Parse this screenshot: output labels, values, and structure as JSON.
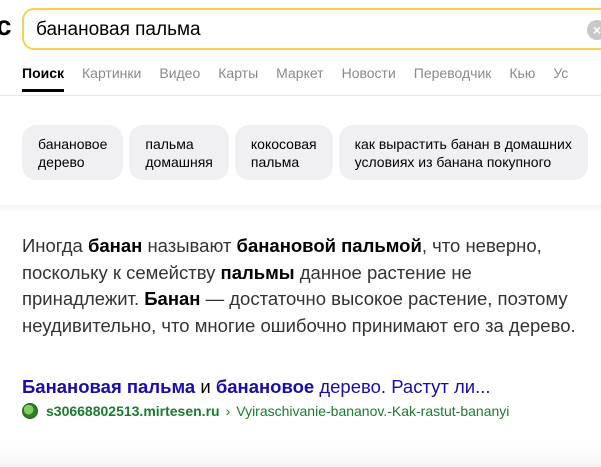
{
  "search": {
    "logo_fragment": "с",
    "query": "банановая пальма",
    "clear_icon": "×"
  },
  "tabs": [
    {
      "label": "Поиск",
      "active": true
    },
    {
      "label": "Картинки",
      "active": false
    },
    {
      "label": "Видео",
      "active": false
    },
    {
      "label": "Карты",
      "active": false
    },
    {
      "label": "Маркет",
      "active": false
    },
    {
      "label": "Новости",
      "active": false
    },
    {
      "label": "Переводчик",
      "active": false
    },
    {
      "label": "Кью",
      "active": false
    },
    {
      "label": "Ус",
      "active": false
    }
  ],
  "related": [
    {
      "line1": "банановое",
      "line2": "дерево"
    },
    {
      "line1": "пальма",
      "line2": "домашняя"
    },
    {
      "line1": "кокосовая",
      "line2": "пальма"
    },
    {
      "line1": "как вырастить банан в домашних",
      "line2": "условиях из банана покупного"
    }
  ],
  "result": {
    "snippet": {
      "p1": "Иногда ",
      "b1": "банан",
      "p2": " называют ",
      "b2": "банановой пальмой",
      "p3": ", что неверно, поскольку к семейству ",
      "b3": "пальмы",
      "p4": " данное растение не принадлежит. ",
      "b4": "Банан",
      "p5": " — достаточно высокое растение, поэтому неудивительно, что многие ошибочно принимают его за дерево."
    },
    "title": {
      "b1": "Банановая пальма",
      "p1": " и ",
      "b2": "банановое",
      "p2": " дерево. Растут ли..."
    },
    "domain": "s30668802513.mirtesen.ru",
    "separator": "›",
    "path": "Vyiraschivanie-bananov.-Kak-rastut-bananyi"
  }
}
